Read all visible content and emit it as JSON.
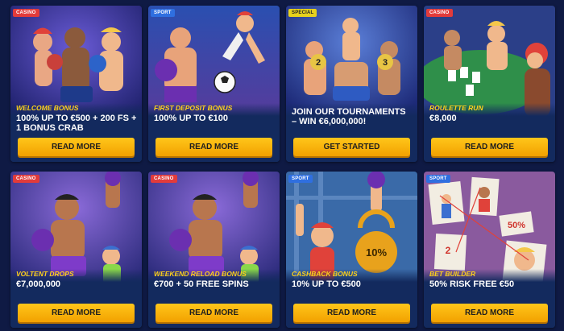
{
  "cards": [
    {
      "tag": "CASINO",
      "label": "WELCOME BONUS",
      "offer": "100% UP TO €500 + 200 FS + 1 BONUS CRAB",
      "button": "READ MORE"
    },
    {
      "tag": "SPORT",
      "label": "FIRST DEPOSIT BONUS",
      "offer": "100% UP TO €100",
      "button": "READ MORE"
    },
    {
      "tag": "SPECIAL",
      "label": "",
      "offer": "JOIN OUR TOURNAMENTS – WIN €6,000,000!",
      "button": "GET STARTED"
    },
    {
      "tag": "CASINO",
      "label": "ROULETTE RUN",
      "offer": "€8,000",
      "button": "READ MORE"
    },
    {
      "tag": "CASINO",
      "label": "VOLTENT DROPS",
      "offer": "€7,000,000",
      "button": "READ MORE"
    },
    {
      "tag": "CASINO",
      "label": "WEEKEND RELOAD BONUS",
      "offer": "€700 + 50 FREE SPINS",
      "button": "READ MORE"
    },
    {
      "tag": "SPORT",
      "label": "CASHBACK BONUS",
      "offer": "10% UP TO €500",
      "button": "READ MORE"
    },
    {
      "tag": "SPORT",
      "label": "BET BUILDER",
      "offer": "50% RISK FREE €50",
      "button": "READ MORE"
    }
  ],
  "art_text": {
    "tournament_badge_left": "2",
    "tournament_badge_right": "3",
    "kettlebell": "10%",
    "bet_note": "50%",
    "bet_note_small": "2"
  },
  "colors": {
    "page_bg": "#0f1a44",
    "card_bg": "#163067",
    "label_yellow": "#ffd21a",
    "button_yellow": "#ffc61a",
    "casino_tag": "#e23b3b",
    "sport_tag": "#2f6fe0",
    "special_tag": "#e8d21c"
  }
}
